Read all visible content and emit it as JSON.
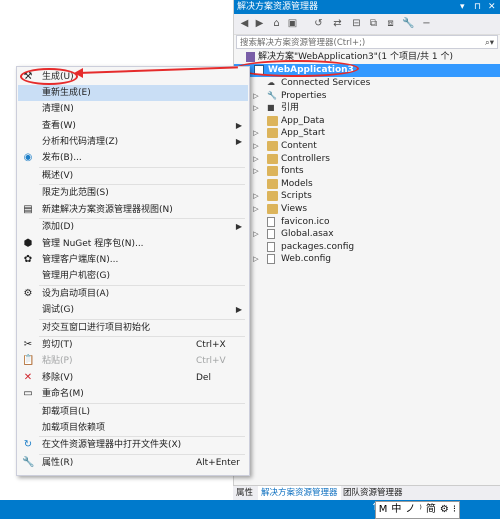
{
  "panel": {
    "title": "解决方案资源管理器",
    "title_buttons": [
      "▾",
      "⊓",
      "✕"
    ],
    "search_placeholder": "搜索解决方案资源管理器(Ctrl+;)",
    "solution_row": "解决方案\"WebApplication3\"(1 个项目/共 1 个)",
    "project": "WebApplication3",
    "items": [
      {
        "label": "Connected Services",
        "kind": "service",
        "expand": false
      },
      {
        "label": "Properties",
        "kind": "wrench",
        "expand": true
      },
      {
        "label": "引用",
        "kind": "ref",
        "expand": true
      },
      {
        "label": "App_Data",
        "kind": "folder",
        "expand": false
      },
      {
        "label": "App_Start",
        "kind": "folder",
        "expand": true
      },
      {
        "label": "Content",
        "kind": "folder",
        "expand": true
      },
      {
        "label": "Controllers",
        "kind": "folder",
        "expand": true
      },
      {
        "label": "fonts",
        "kind": "folder",
        "expand": true
      },
      {
        "label": "Models",
        "kind": "folder",
        "expand": false
      },
      {
        "label": "Scripts",
        "kind": "folder",
        "expand": true
      },
      {
        "label": "Views",
        "kind": "folder",
        "expand": true
      },
      {
        "label": "favicon.ico",
        "kind": "file",
        "expand": false
      },
      {
        "label": "Global.asax",
        "kind": "file",
        "expand": true
      },
      {
        "label": "packages.config",
        "kind": "file",
        "expand": false
      },
      {
        "label": "Web.config",
        "kind": "file",
        "expand": true
      }
    ],
    "bottom_tabs": [
      "属性",
      "解决方案资源管理器",
      "团队资源管理器"
    ]
  },
  "statusbar": {
    "ime": [
      "M",
      "中",
      "ノ",
      "⁾",
      "简",
      "⚙",
      "⁝"
    ]
  },
  "menu": {
    "items": [
      {
        "label": "生成(U)",
        "icon": "build-icon",
        "glyph": "⚒",
        "shortcut": "",
        "submenu": false,
        "state": "normal"
      },
      {
        "label": "重新生成(E)",
        "icon": "",
        "glyph": "",
        "shortcut": "",
        "submenu": false,
        "state": "hover"
      },
      {
        "label": "清理(N)",
        "icon": "",
        "glyph": "",
        "shortcut": "",
        "submenu": false,
        "state": "normal"
      },
      {
        "label": "查看(W)",
        "icon": "",
        "glyph": "",
        "shortcut": "",
        "submenu": true,
        "state": "normal"
      },
      {
        "label": "分析和代码清理(Z)",
        "icon": "",
        "glyph": "",
        "shortcut": "",
        "submenu": true,
        "state": "normal"
      },
      {
        "label": "发布(B)...",
        "icon": "globe-icon",
        "glyph": "◉",
        "shortcut": "",
        "submenu": false,
        "state": "normal",
        "sep_after": true
      },
      {
        "label": "概述(V)",
        "icon": "",
        "glyph": "",
        "shortcut": "",
        "submenu": false,
        "state": "normal",
        "sep_after": true
      },
      {
        "label": "限定为此范围(S)",
        "icon": "",
        "glyph": "",
        "shortcut": "",
        "submenu": false,
        "state": "normal"
      },
      {
        "label": "新建解决方案资源管理器视图(N)",
        "icon": "explorer-view-icon",
        "glyph": "▤",
        "shortcut": "",
        "submenu": false,
        "state": "normal",
        "sep_after": true
      },
      {
        "label": "添加(D)",
        "icon": "",
        "glyph": "",
        "shortcut": "",
        "submenu": true,
        "state": "normal"
      },
      {
        "label": "管理 NuGet 程序包(N)...",
        "icon": "nuget-icon",
        "glyph": "⬢",
        "shortcut": "",
        "submenu": false,
        "state": "normal"
      },
      {
        "label": "管理客户端库(N)...",
        "icon": "library-icon",
        "glyph": "✿",
        "shortcut": "",
        "submenu": false,
        "state": "normal"
      },
      {
        "label": "管理用户机密(G)",
        "icon": "",
        "glyph": "",
        "shortcut": "",
        "submenu": false,
        "state": "normal",
        "sep_after": true
      },
      {
        "label": "设为启动项目(A)",
        "icon": "gear-icon",
        "glyph": "⚙",
        "shortcut": "",
        "submenu": false,
        "state": "normal"
      },
      {
        "label": "调试(G)",
        "icon": "",
        "glyph": "",
        "shortcut": "",
        "submenu": true,
        "state": "normal",
        "sep_after": true
      },
      {
        "label": "对交互窗口进行项目初始化",
        "icon": "",
        "glyph": "",
        "shortcut": "",
        "submenu": false,
        "state": "normal",
        "sep_after": true
      },
      {
        "label": "剪切(T)",
        "icon": "scissors-icon",
        "glyph": "✂",
        "shortcut": "Ctrl+X",
        "submenu": false,
        "state": "normal"
      },
      {
        "label": "粘贴(P)",
        "icon": "paste-icon",
        "glyph": "📋",
        "shortcut": "Ctrl+V",
        "submenu": false,
        "state": "disabled"
      },
      {
        "label": "移除(V)",
        "icon": "delete-icon",
        "glyph": "✕",
        "shortcut": "Del",
        "submenu": false,
        "state": "normal"
      },
      {
        "label": "重命名(M)",
        "icon": "rename-icon",
        "glyph": "▭",
        "shortcut": "",
        "submenu": false,
        "state": "normal",
        "sep_after": true
      },
      {
        "label": "卸载项目(L)",
        "icon": "",
        "glyph": "",
        "shortcut": "",
        "submenu": false,
        "state": "normal"
      },
      {
        "label": "加载项目依赖项",
        "icon": "",
        "glyph": "",
        "shortcut": "",
        "submenu": false,
        "state": "normal",
        "sep_after": true
      },
      {
        "label": "在文件资源管理器中打开文件夹(X)",
        "icon": "open-folder-icon",
        "glyph": "↻",
        "shortcut": "",
        "submenu": false,
        "state": "normal",
        "sep_after": true
      },
      {
        "label": "属性(R)",
        "icon": "wrench-icon",
        "glyph": "🔧",
        "shortcut": "Alt+Enter",
        "submenu": false,
        "state": "normal"
      }
    ]
  },
  "colors": {
    "accent": "#007acc",
    "selection": "#3399ff",
    "annotation": "#e52b2b",
    "menu_hover": "#c9def5"
  }
}
